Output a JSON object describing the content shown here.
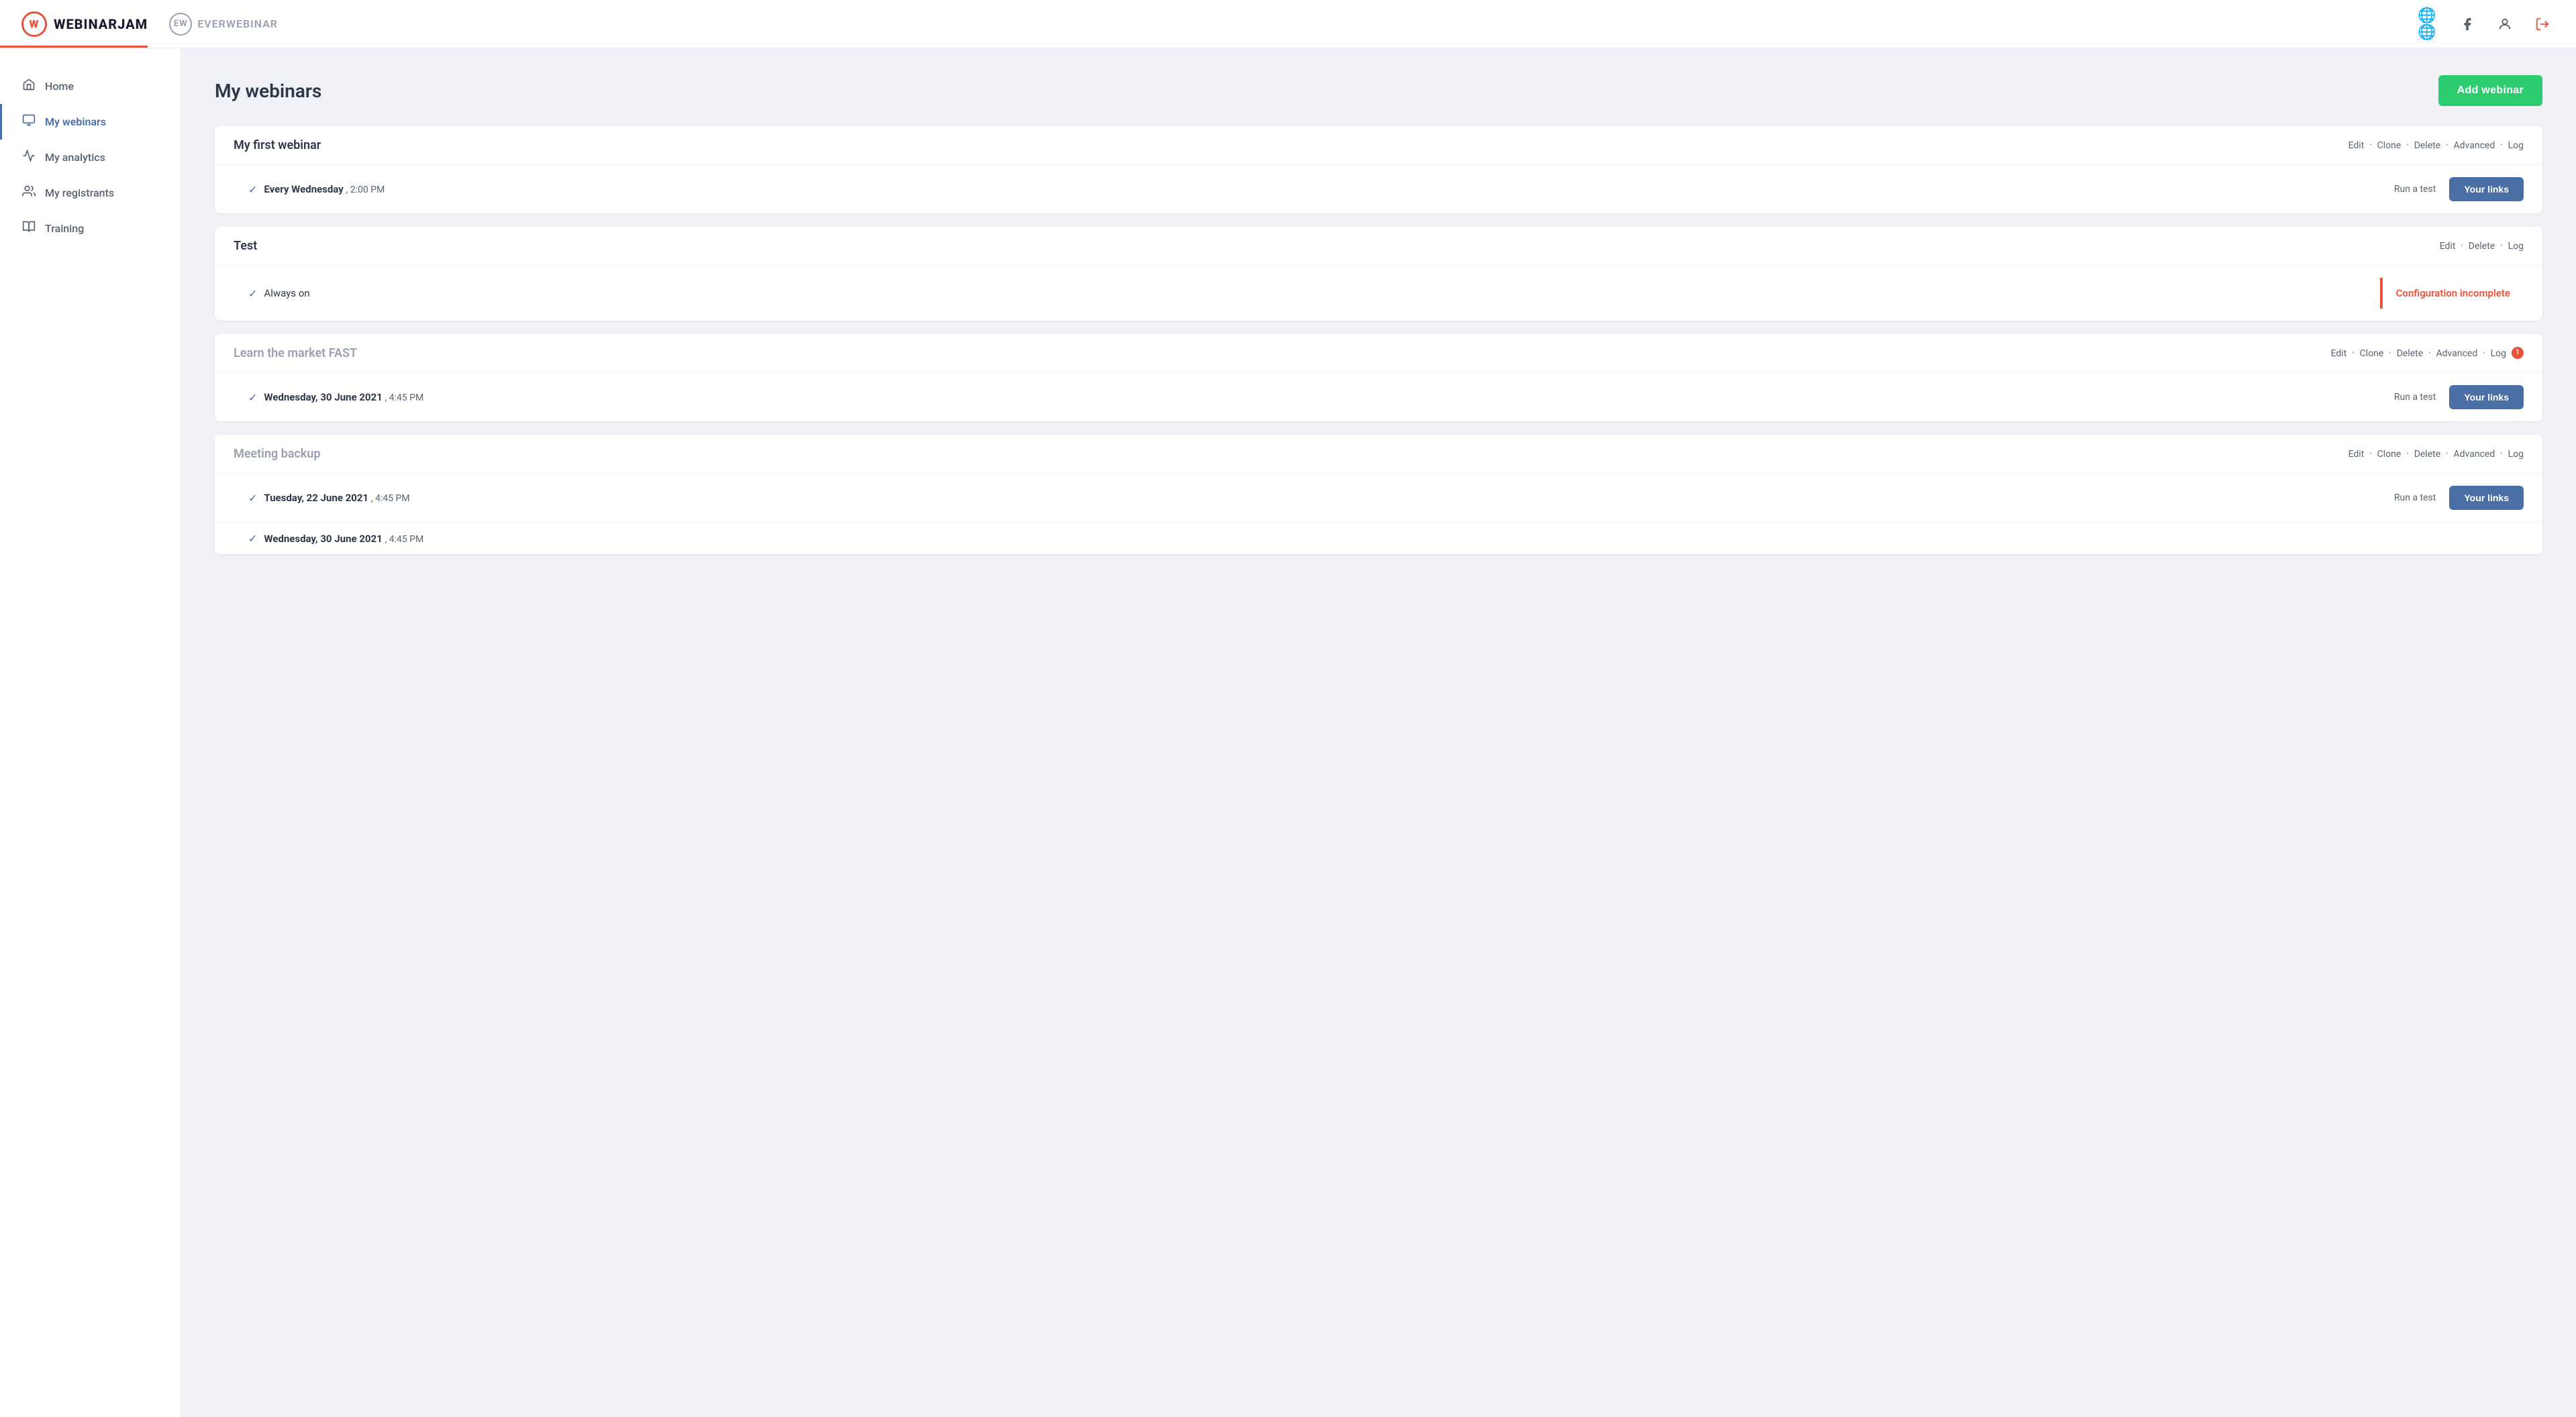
{
  "header": {
    "logo_wj_letter": "W",
    "logo_wj_text": "WEBINARJAM",
    "logo_ew_letter": "EW",
    "logo_ew_text": "EVERWEBINAR"
  },
  "sidebar": {
    "items": [
      {
        "id": "home",
        "label": "Home",
        "icon": "home",
        "active": false
      },
      {
        "id": "my-webinars",
        "label": "My webinars",
        "icon": "webinars",
        "active": true
      },
      {
        "id": "my-analytics",
        "label": "My analytics",
        "icon": "analytics",
        "active": false
      },
      {
        "id": "my-registrants",
        "label": "My registrants",
        "icon": "registrants",
        "active": false
      },
      {
        "id": "training",
        "label": "Training",
        "icon": "training",
        "active": false
      }
    ]
  },
  "main": {
    "title": "My webinars",
    "add_button": "Add webinar",
    "webinars": [
      {
        "id": "first",
        "title": "My first webinar",
        "title_muted": false,
        "actions": [
          "Edit",
          "Clone",
          "Delete",
          "Advanced",
          "Log"
        ],
        "notification": null,
        "sessions": [
          {
            "schedule": "Every Wednesday",
            "time": "2:00 PM",
            "run_test": "Run a test",
            "your_links": "Your links",
            "config_incomplete": false
          }
        ]
      },
      {
        "id": "test",
        "title": "Test",
        "title_muted": false,
        "actions": [
          "Edit",
          "Delete",
          "Log"
        ],
        "notification": null,
        "sessions": [
          {
            "schedule": "Always on",
            "time": null,
            "run_test": null,
            "your_links": null,
            "config_incomplete": true,
            "config_text": "Configuration incomplete"
          }
        ]
      },
      {
        "id": "learn-market",
        "title": "Learn the market FAST",
        "title_muted": true,
        "actions": [
          "Edit",
          "Clone",
          "Delete",
          "Advanced",
          "Log"
        ],
        "notification": "1",
        "sessions": [
          {
            "schedule": "Wednesday, 30 June 2021",
            "time": "4:45 PM",
            "run_test": "Run a test",
            "your_links": "Your links",
            "config_incomplete": false
          }
        ]
      },
      {
        "id": "meeting-backup",
        "title": "Meeting backup",
        "title_muted": true,
        "actions": [
          "Edit",
          "Clone",
          "Delete",
          "Advanced",
          "Log"
        ],
        "notification": null,
        "sessions": [
          {
            "schedule": "Tuesday, 22 June 2021",
            "time": "4:45 PM",
            "run_test": "Run a test",
            "your_links": "Your links",
            "config_incomplete": false
          },
          {
            "schedule": "Wednesday, 30 June 2021",
            "time": "4:45 PM",
            "run_test": null,
            "your_links": null,
            "config_incomplete": false
          }
        ]
      }
    ]
  }
}
